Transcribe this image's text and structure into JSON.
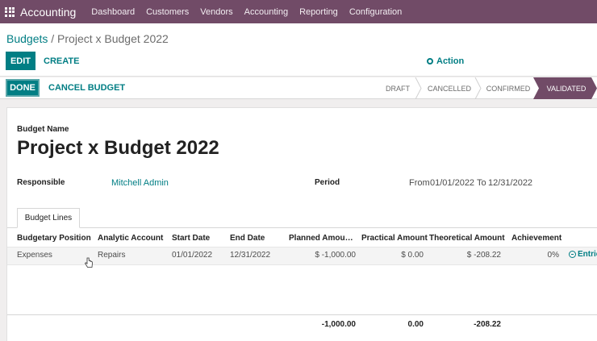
{
  "topbar": {
    "app_name": "Accounting",
    "menu": [
      "Dashboard",
      "Customers",
      "Vendors",
      "Accounting",
      "Reporting",
      "Configuration"
    ]
  },
  "breadcrumb": {
    "parent": "Budgets",
    "separator": " / ",
    "current": "Project x Budget 2022"
  },
  "actions": {
    "edit": "EDIT",
    "create": "CREATE",
    "action": "Action"
  },
  "statusbar": {
    "done": "DONE",
    "cancel": "CANCEL BUDGET",
    "stages": [
      "DRAFT",
      "CANCELLED",
      "CONFIRMED",
      "VALIDATED"
    ],
    "active_stage": "VALIDATED"
  },
  "form": {
    "name_label": "Budget Name",
    "name": "Project x Budget 2022",
    "responsible_label": "Responsible",
    "responsible": "Mitchell Admin",
    "period_label": "Period",
    "period_from_label": "From",
    "period_from": "01/01/2022",
    "period_to_label": "To",
    "period_to": "12/31/2022"
  },
  "tab": {
    "label": "Budget Lines"
  },
  "table": {
    "headers": [
      "Budgetary Position",
      "Analytic Account",
      "Start Date",
      "End Date",
      "Planned Amou…",
      "Practical Amount",
      "Theoretical Amount",
      "Achievement"
    ],
    "rows": [
      {
        "position": "Expenses",
        "account": "Repairs",
        "start": "01/01/2022",
        "end": "12/31/2022",
        "planned": "$ -1,000.00",
        "practical": "$ 0.00",
        "theoretical": "$ -208.22",
        "achievement": "0%",
        "entries": "Entries"
      }
    ],
    "totals": {
      "planned": "-1,000.00",
      "practical": "0.00",
      "theoretical": "-208.22"
    }
  },
  "colors": {
    "brand": "#714b67",
    "accent": "#017e84"
  }
}
